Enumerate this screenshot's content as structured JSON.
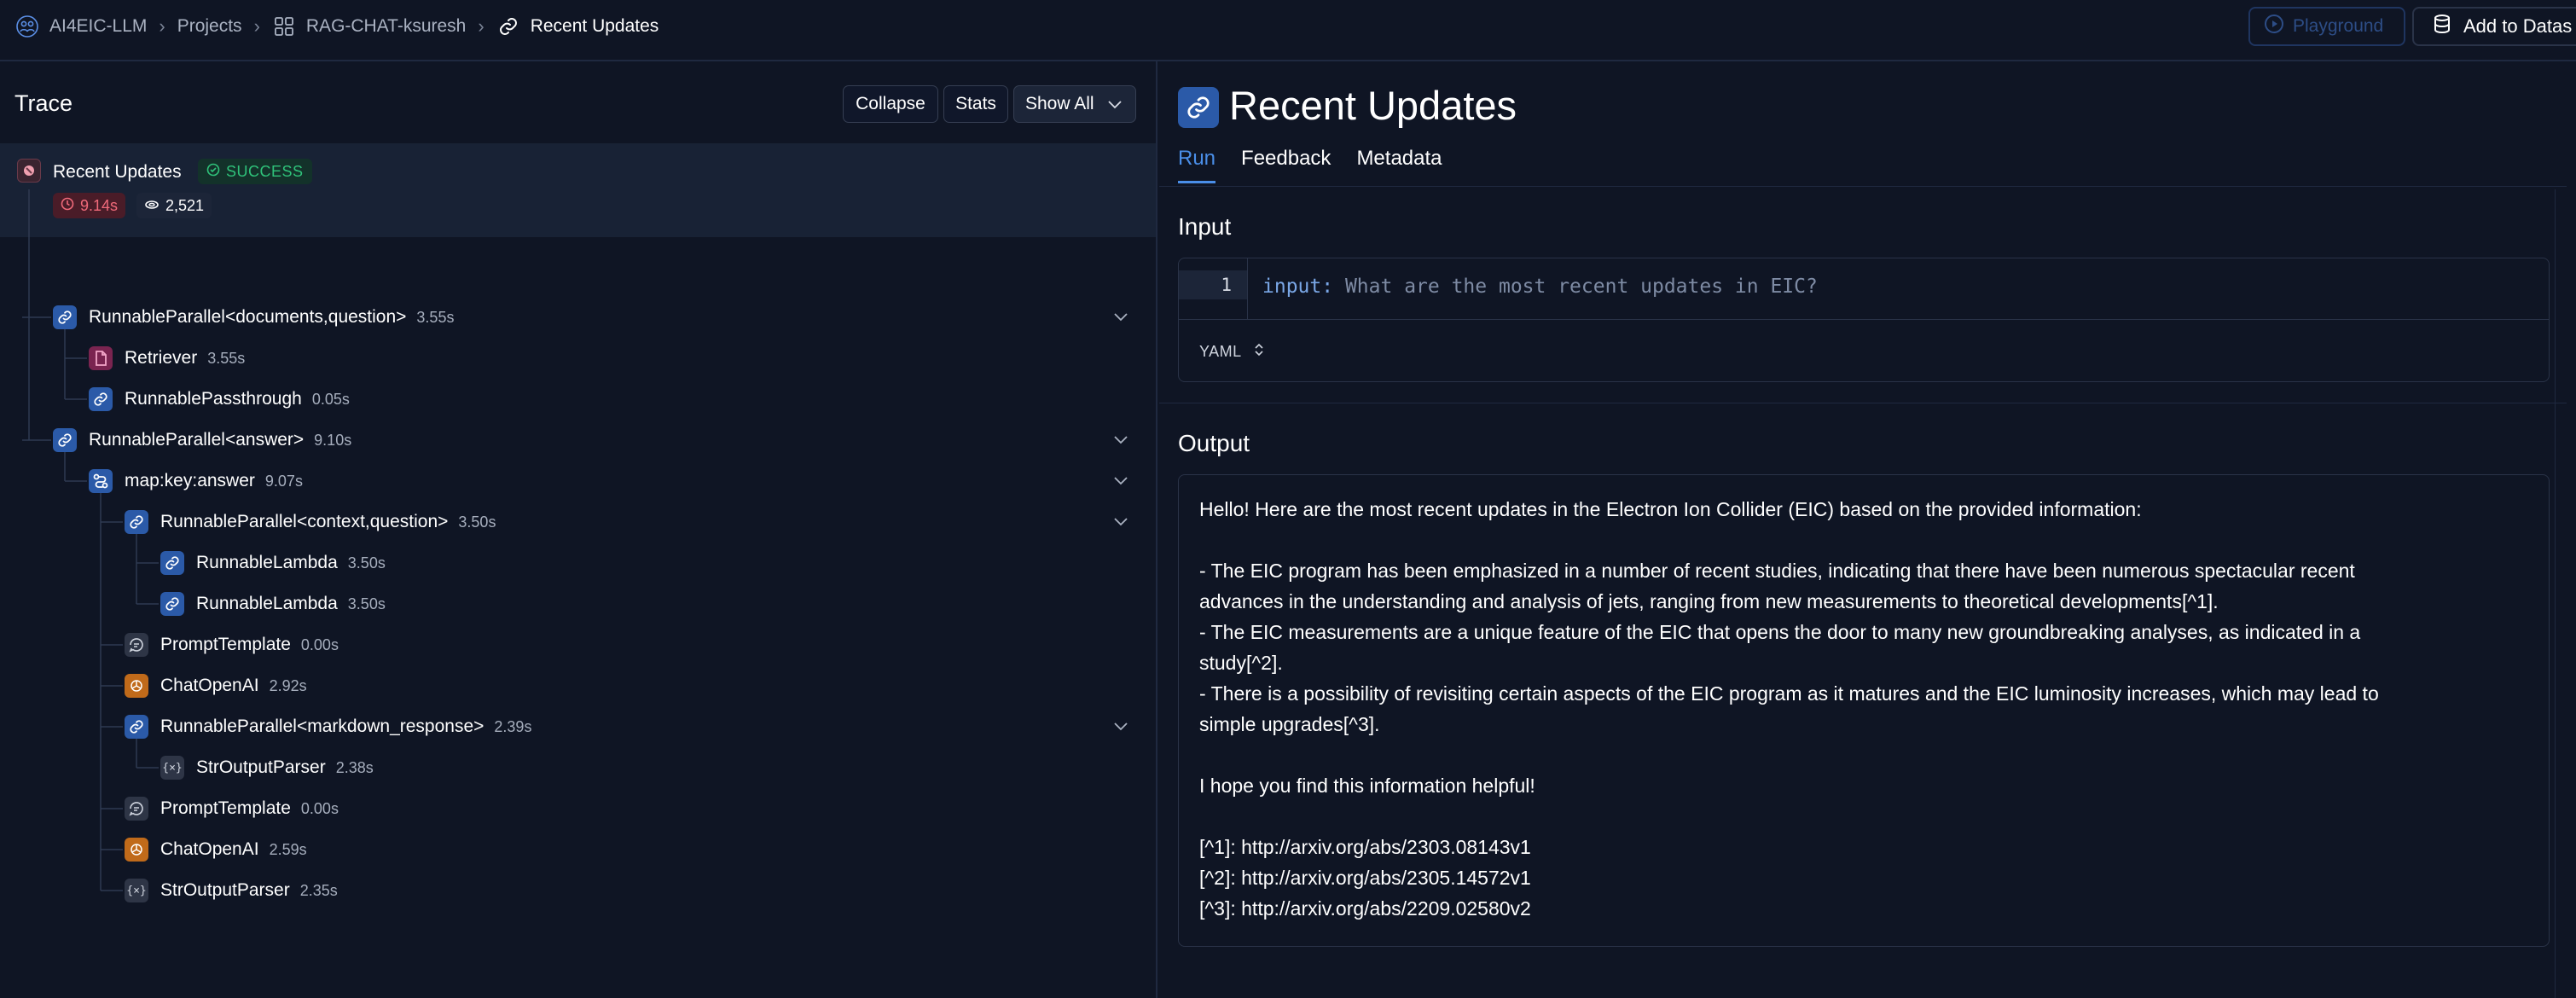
{
  "breadcrumb": {
    "org": "AI4EIC-LLM",
    "projects": "Projects",
    "project": "RAG-CHAT-ksuresh",
    "current": "Recent Updates"
  },
  "header": {
    "playground_label": "Playground",
    "add_dataset_label": "Add to Datas"
  },
  "trace": {
    "title": "Trace",
    "collapse_label": "Collapse",
    "stats_label": "Stats",
    "show_all_label": "Show All",
    "root": {
      "name": "Recent Updates",
      "status": "SUCCESS",
      "latency": "9.14s",
      "tokens": "2,521"
    },
    "nodes": [
      {
        "name": "RunnableParallel<documents,question>",
        "duration": "3.55s",
        "icon": "link-icon",
        "color": "blue",
        "expandable": true
      },
      {
        "name": "Retriever",
        "duration": "3.55s",
        "icon": "document-icon",
        "color": "pink",
        "expandable": false
      },
      {
        "name": "RunnablePassthrough",
        "duration": "0.05s",
        "icon": "link-icon",
        "color": "blue",
        "expandable": false
      },
      {
        "name": "RunnableParallel<answer>",
        "duration": "9.10s",
        "icon": "link-icon",
        "color": "blue",
        "expandable": true
      },
      {
        "name": "map:key:answer",
        "duration": "9.07s",
        "icon": "map-icon",
        "color": "blue",
        "expandable": true
      },
      {
        "name": "RunnableParallel<context,question>",
        "duration": "3.50s",
        "icon": "link-icon",
        "color": "blue",
        "expandable": true
      },
      {
        "name": "RunnableLambda",
        "duration": "3.50s",
        "icon": "link-icon",
        "color": "blue",
        "expandable": false
      },
      {
        "name": "RunnableLambda",
        "duration": "3.50s",
        "icon": "link-icon",
        "color": "blue",
        "expandable": false
      },
      {
        "name": "PromptTemplate",
        "duration": "0.00s",
        "icon": "prompt-icon",
        "color": "gray",
        "expandable": false
      },
      {
        "name": "ChatOpenAI",
        "duration": "2.92s",
        "icon": "openai-icon",
        "color": "orange",
        "expandable": false
      },
      {
        "name": "RunnableParallel<markdown_response>",
        "duration": "2.39s",
        "icon": "link-icon",
        "color": "blue",
        "expandable": true
      },
      {
        "name": "StrOutputParser",
        "duration": "2.38s",
        "icon": "parser-icon",
        "color": "gray",
        "expandable": false
      },
      {
        "name": "PromptTemplate",
        "duration": "0.00s",
        "icon": "prompt-icon",
        "color": "gray",
        "expandable": false
      },
      {
        "name": "ChatOpenAI",
        "duration": "2.59s",
        "icon": "openai-icon",
        "color": "orange",
        "expandable": false
      },
      {
        "name": "StrOutputParser",
        "duration": "2.35s",
        "icon": "parser-icon",
        "color": "gray",
        "expandable": false
      }
    ]
  },
  "run": {
    "title": "Recent Updates",
    "tabs": [
      "Run",
      "Feedback",
      "Metadata"
    ],
    "active_tab": "Run",
    "input_heading": "Input",
    "input_line_number": "1",
    "input_key": "input:",
    "input_value": "What are the most recent updates in EIC?",
    "format_label": "YAML",
    "output_heading": "Output",
    "output_lines": [
      "Hello! Here are the most recent updates in the Electron Ion Collider (EIC) based on the provided information:",
      "",
      "- The EIC program has been emphasized in a number of recent studies, indicating that there have been numerous spectacular recent",
      "advances in the understanding and analysis of jets, ranging from new measurements to theoretical developments[^1].",
      "- The EIC measurements are a unique feature of the EIC that opens the door to many new groundbreaking analyses, as indicated in a",
      "study[^2].",
      "- There is a possibility of revisiting certain aspects of the EIC program as it matures and the EIC luminosity increases, which may lead to",
      "simple upgrades[^3].",
      "",
      "I hope you find this information helpful!",
      "",
      "[^1]: http://arxiv.org/abs/2303.08143v1",
      "[^2]: http://arxiv.org/abs/2305.14572v1",
      "[^3]: http://arxiv.org/abs/2209.02580v2"
    ]
  }
}
